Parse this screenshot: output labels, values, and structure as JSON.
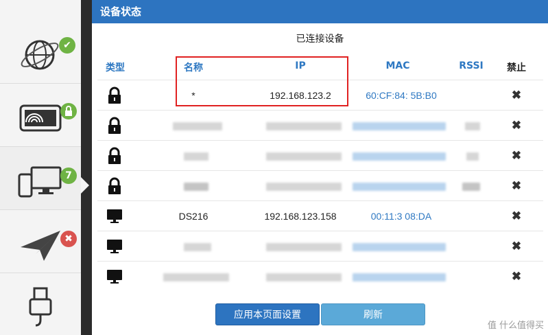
{
  "sidebar": {
    "items": [
      {
        "icon": "globe-network-icon",
        "badge": "✔",
        "badge_icon": "check-badge-icon"
      },
      {
        "icon": "wifi-tablet-icon",
        "badge": "",
        "badge_icon": "lock-badge-icon"
      },
      {
        "icon": "devices-icon",
        "badge": "7",
        "badge_icon": "count-badge-icon"
      },
      {
        "icon": "paper-plane-icon",
        "badge": "✖",
        "badge_icon": "error-badge-icon"
      },
      {
        "icon": "usb-icon",
        "badge": "",
        "badge_icon": ""
      }
    ]
  },
  "panel": {
    "title": "设备状态",
    "subtitle": "已连接设备"
  },
  "table": {
    "headers": {
      "type": "类型",
      "name": "名称",
      "ip": "IP",
      "mac": "MAC",
      "rssi": "RSSI",
      "block": "禁止"
    },
    "rows": [
      {
        "type": "lock",
        "name": "*",
        "ip": "192.168.123.2",
        "mac": "60:CF:84:  5B:B0",
        "rssi": "",
        "block": "✖"
      },
      {
        "type": "lock",
        "name": "",
        "ip": "",
        "mac": "",
        "rssi": "",
        "block": "✖"
      },
      {
        "type": "lock",
        "name": "",
        "ip": "",
        "mac": "",
        "rssi": "",
        "block": "✖"
      },
      {
        "type": "lock",
        "name": "",
        "ip": "",
        "mac": "",
        "rssi": "",
        "block": "✖"
      },
      {
        "type": "monitor",
        "name": "DS216",
        "ip": "192.168.123.158",
        "mac": "00:11:3  08:DA",
        "rssi": "",
        "block": "✖"
      },
      {
        "type": "monitor",
        "name": "",
        "ip": "",
        "mac": "",
        "rssi": "",
        "block": "✖"
      },
      {
        "type": "monitor",
        "name": "",
        "ip": "",
        "mac": "",
        "rssi": "",
        "block": "✖"
      }
    ]
  },
  "buttons": {
    "apply": "应用本页面设置",
    "refresh": "刷新"
  },
  "watermark": "值 什么值得买",
  "colors": {
    "header": "#2d74c0",
    "link": "#2e78c2",
    "badge_green": "#6fb344",
    "badge_red": "#d9534f",
    "highlight_box": "#e02020"
  }
}
